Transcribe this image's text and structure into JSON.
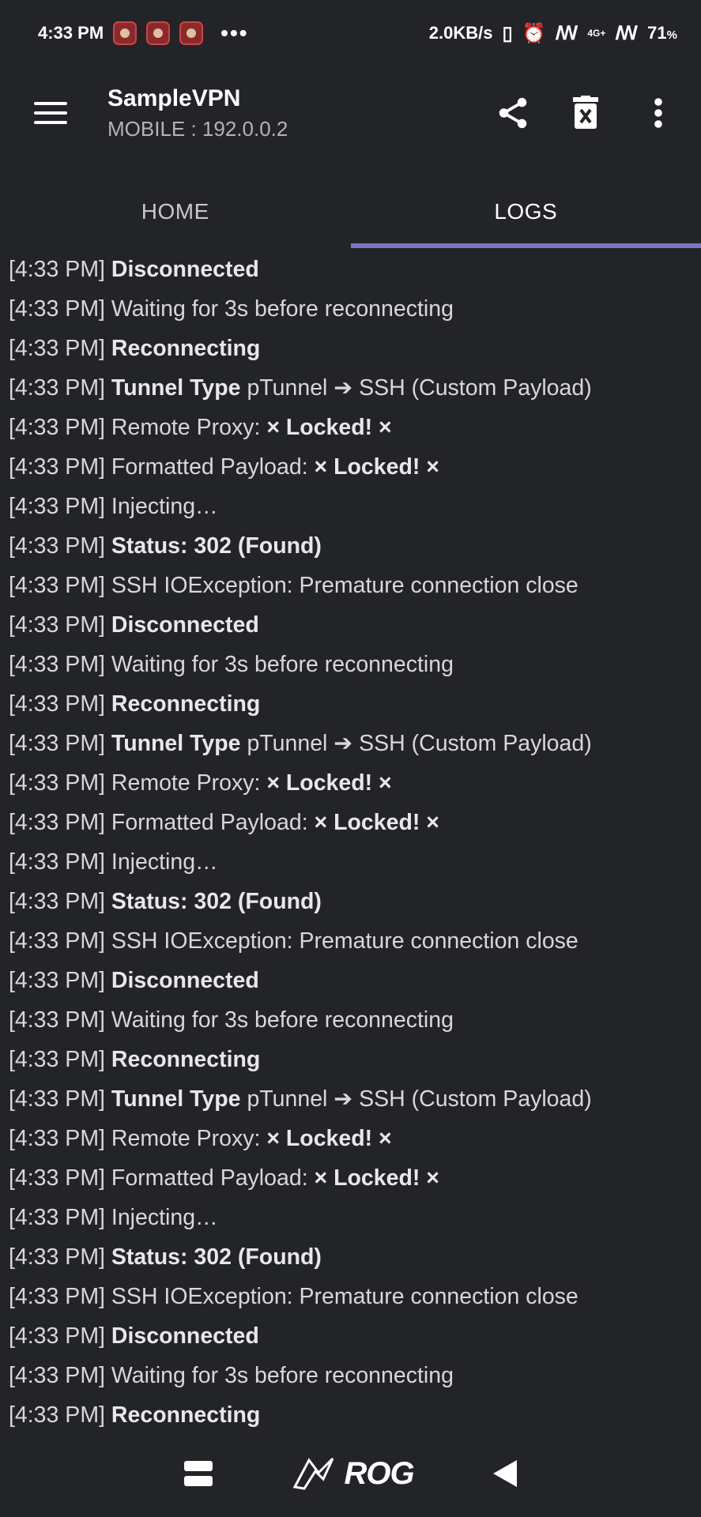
{
  "status_bar": {
    "time": "4:33 PM",
    "more": "•••",
    "speed": "2.0KB/s",
    "network_label": "4G+",
    "battery_value": "71",
    "battery_unit": "%"
  },
  "app_bar": {
    "title": "SampleVPN",
    "subtitle": "MOBILE : 192.0.0.2"
  },
  "tabs": [
    {
      "label": "HOME",
      "active": false
    },
    {
      "label": "LOGS",
      "active": true
    }
  ],
  "logs": [
    {
      "time": "[4:33 PM]",
      "strong": "Disconnected",
      "text": ""
    },
    {
      "time": "[4:33 PM]",
      "strong": "",
      "text": "Waiting for 3s before reconnecting"
    },
    {
      "time": "[4:33 PM]",
      "strong": "Reconnecting",
      "text": ""
    },
    {
      "time": "[4:33 PM]",
      "strong": "Tunnel Type",
      "text": "pTunnel ➔ SSH (Custom Payload)"
    },
    {
      "time": "[4:33 PM]",
      "strong": "",
      "text": "Remote Proxy:",
      "tail": "× Locked! ×"
    },
    {
      "time": "[4:33 PM]",
      "strong": "",
      "text": "Formatted Payload:",
      "tail": "× Locked! ×"
    },
    {
      "time": "[4:33 PM]",
      "strong": "",
      "text": "Injecting…"
    },
    {
      "time": "[4:33 PM]",
      "strong": "Status: 302 (Found)",
      "text": ""
    },
    {
      "time": "[4:33 PM]",
      "strong": "",
      "text": "SSH IOException: Premature connection close"
    },
    {
      "time": "[4:33 PM]",
      "strong": "Disconnected",
      "text": ""
    },
    {
      "time": "[4:33 PM]",
      "strong": "",
      "text": "Waiting for 3s before reconnecting"
    },
    {
      "time": "[4:33 PM]",
      "strong": "Reconnecting",
      "text": ""
    },
    {
      "time": "[4:33 PM]",
      "strong": "Tunnel Type",
      "text": "pTunnel ➔ SSH (Custom Payload)"
    },
    {
      "time": "[4:33 PM]",
      "strong": "",
      "text": "Remote Proxy:",
      "tail": "× Locked! ×"
    },
    {
      "time": "[4:33 PM]",
      "strong": "",
      "text": "Formatted Payload:",
      "tail": "× Locked! ×"
    },
    {
      "time": "[4:33 PM]",
      "strong": "",
      "text": "Injecting…"
    },
    {
      "time": "[4:33 PM]",
      "strong": "Status: 302 (Found)",
      "text": ""
    },
    {
      "time": "[4:33 PM]",
      "strong": "",
      "text": "SSH IOException: Premature connection close"
    },
    {
      "time": "[4:33 PM]",
      "strong": "Disconnected",
      "text": ""
    },
    {
      "time": "[4:33 PM]",
      "strong": "",
      "text": "Waiting for 3s before reconnecting"
    },
    {
      "time": "[4:33 PM]",
      "strong": "Reconnecting",
      "text": ""
    },
    {
      "time": "[4:33 PM]",
      "strong": "Tunnel Type",
      "text": "pTunnel ➔ SSH (Custom Payload)"
    },
    {
      "time": "[4:33 PM]",
      "strong": "",
      "text": "Remote Proxy:",
      "tail": "× Locked! ×"
    },
    {
      "time": "[4:33 PM]",
      "strong": "",
      "text": "Formatted Payload:",
      "tail": "× Locked! ×"
    },
    {
      "time": "[4:33 PM]",
      "strong": "",
      "text": "Injecting…"
    },
    {
      "time": "[4:33 PM]",
      "strong": "Status: 302 (Found)",
      "text": ""
    },
    {
      "time": "[4:33 PM]",
      "strong": "",
      "text": "SSH IOException: Premature connection close"
    },
    {
      "time": "[4:33 PM]",
      "strong": "Disconnected",
      "text": ""
    },
    {
      "time": "[4:33 PM]",
      "strong": "",
      "text": "Waiting for 3s before reconnecting"
    },
    {
      "time": "[4:33 PM]",
      "strong": "Reconnecting",
      "text": ""
    }
  ],
  "nav_bar": {
    "brand": "ROG"
  },
  "icons": {
    "menu": "hamburger-icon",
    "share": "share-icon",
    "clear": "delete-icon",
    "more": "more-vert-icon",
    "back": "back-icon",
    "recents": "recents-icon",
    "home": "rog-logo-icon"
  },
  "colors": {
    "background": "#232428",
    "tab_indicator": "#7b74c9",
    "text": "#d8d8dc"
  }
}
